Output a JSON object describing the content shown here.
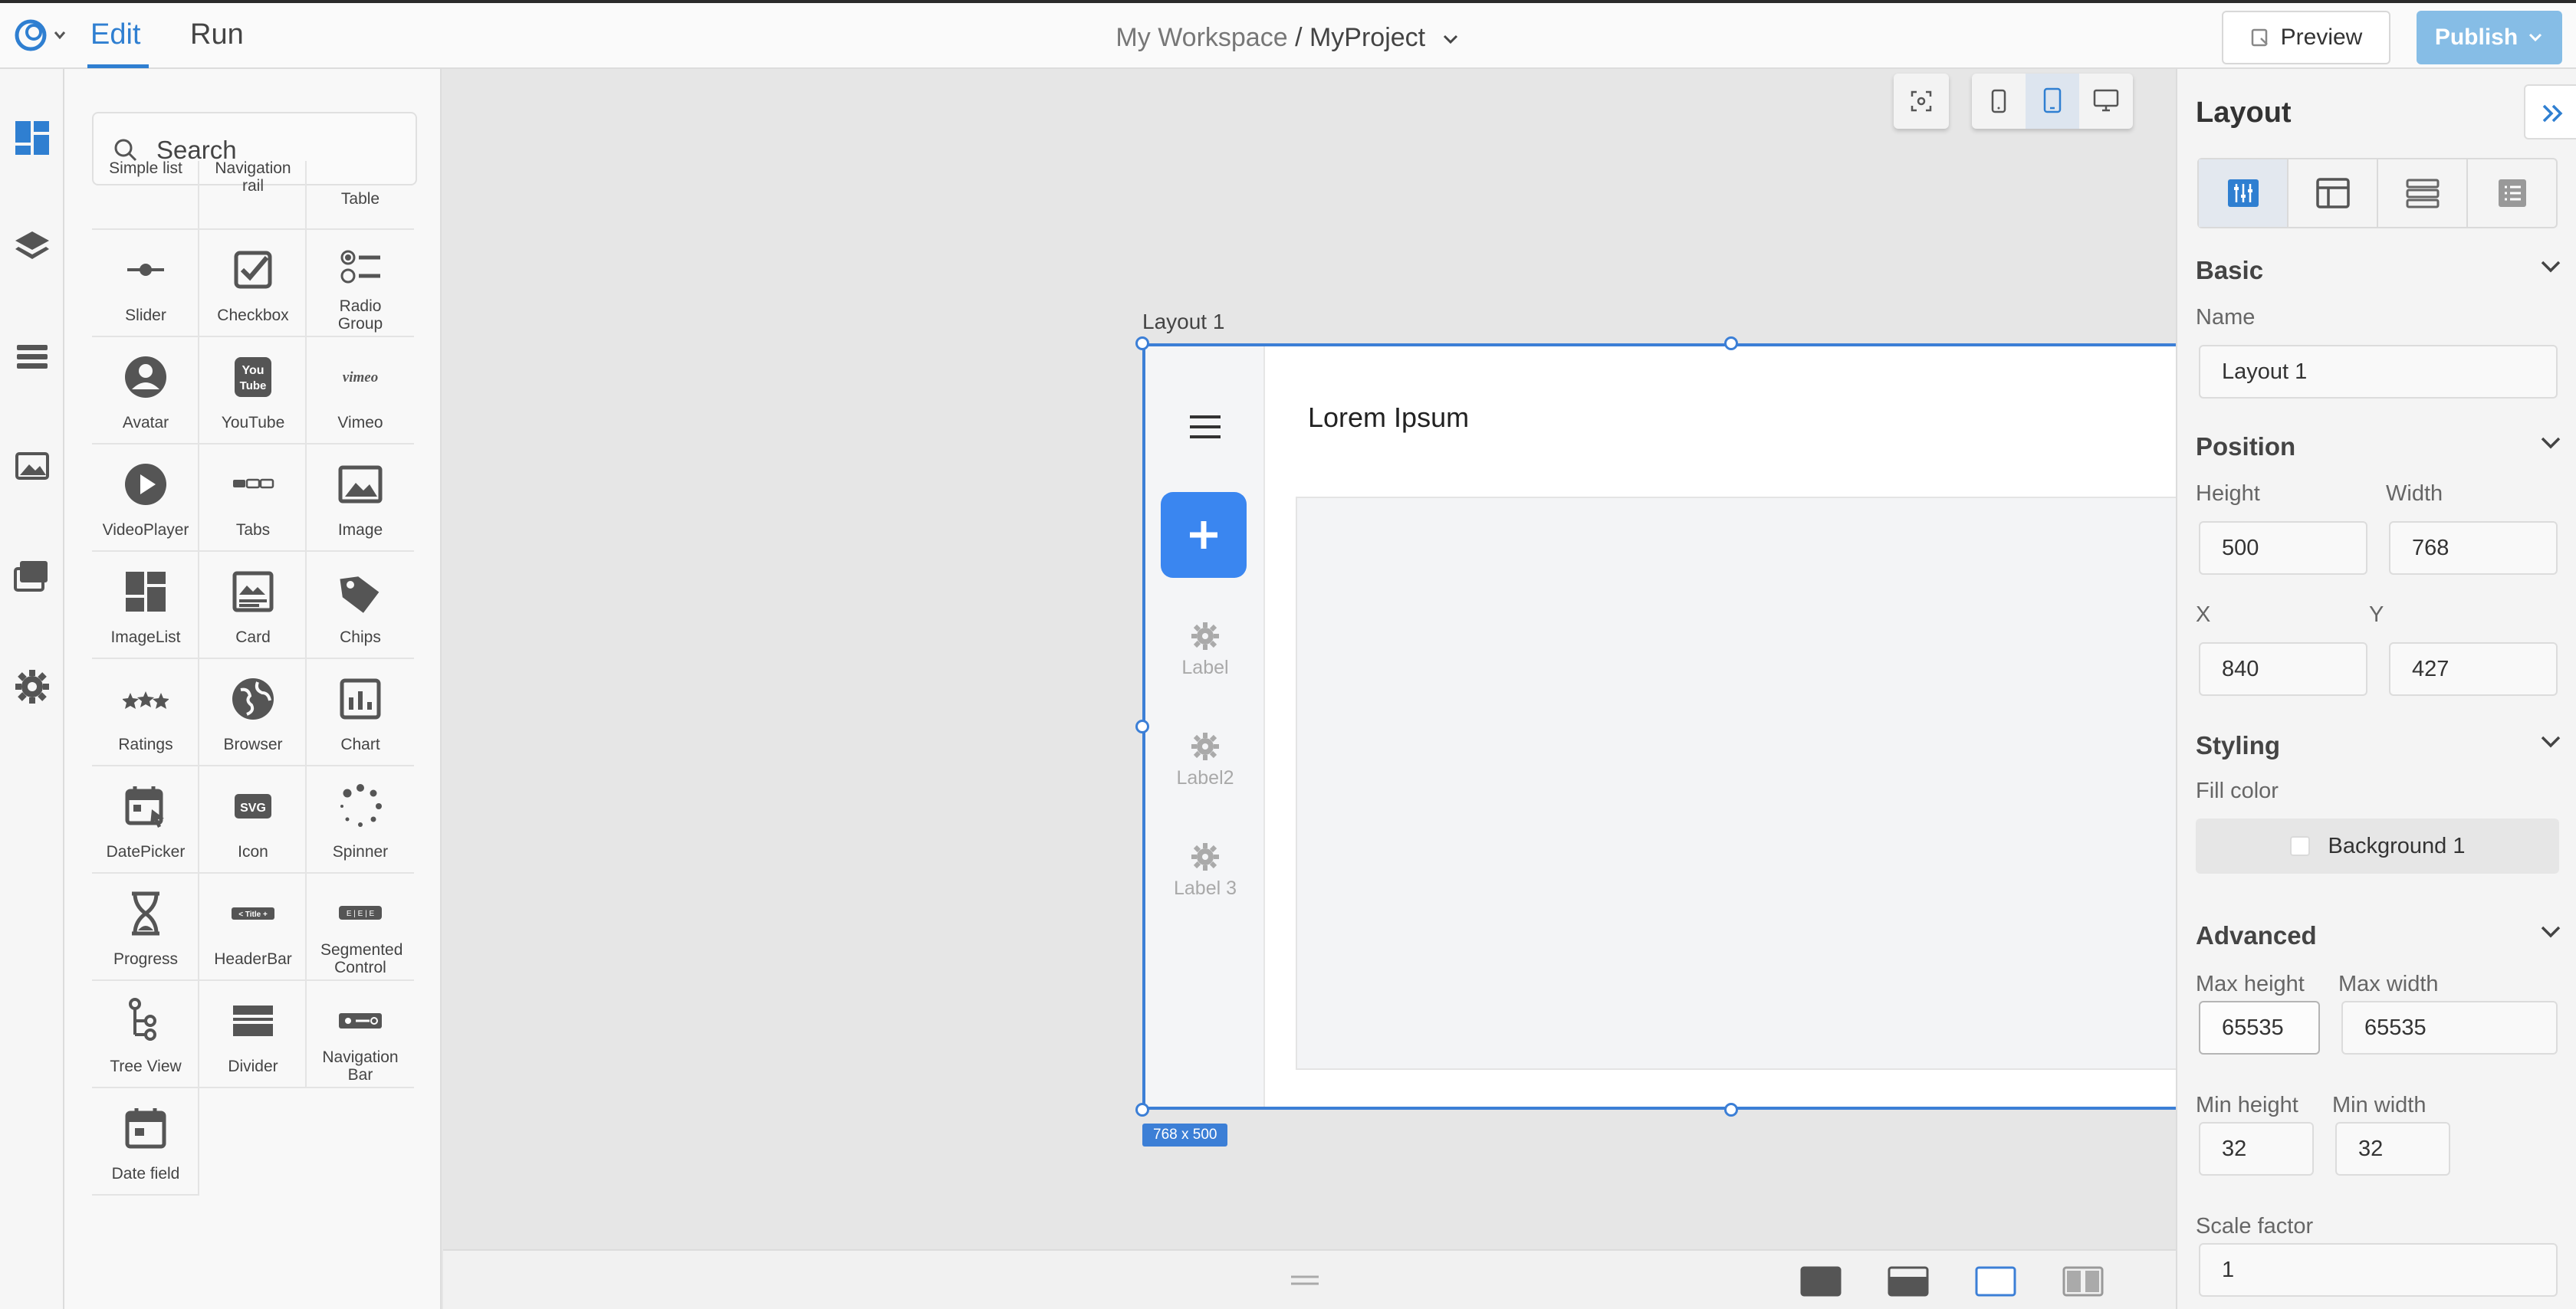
{
  "topbar": {
    "tabs": [
      {
        "label": "Edit"
      },
      {
        "label": "Run"
      }
    ],
    "breadcrumb": {
      "workspace": "My Workspace",
      "separator": " / ",
      "project": "MyProject"
    },
    "preview_label": "Preview",
    "publish_label": "Publish"
  },
  "palette": {
    "search_placeholder": "Search",
    "items": [
      {
        "label": "Simple list",
        "icon": "simple-list-icon"
      },
      {
        "label": "Navigation rail",
        "icon": "navigation-rail-icon"
      },
      {
        "label": "Table",
        "icon": "table-icon"
      },
      {
        "label": "Slider",
        "icon": "slider-icon"
      },
      {
        "label": "Checkbox",
        "icon": "checkbox-icon"
      },
      {
        "label": "Radio Group",
        "icon": "radio-group-icon"
      },
      {
        "label": "Avatar",
        "icon": "avatar-icon"
      },
      {
        "label": "YouTube",
        "icon": "youtube-icon"
      },
      {
        "label": "Vimeo",
        "icon": "vimeo-icon"
      },
      {
        "label": "VideoPlayer",
        "icon": "video-player-icon"
      },
      {
        "label": "Tabs",
        "icon": "tabs-icon"
      },
      {
        "label": "Image",
        "icon": "image-icon"
      },
      {
        "label": "ImageList",
        "icon": "image-list-icon"
      },
      {
        "label": "Card",
        "icon": "card-icon"
      },
      {
        "label": "Chips",
        "icon": "chips-icon"
      },
      {
        "label": "Ratings",
        "icon": "ratings-icon"
      },
      {
        "label": "Browser",
        "icon": "browser-icon"
      },
      {
        "label": "Chart",
        "icon": "chart-icon"
      },
      {
        "label": "DatePicker",
        "icon": "date-picker-icon"
      },
      {
        "label": "Icon",
        "icon": "svg-icon"
      },
      {
        "label": "Spinner",
        "icon": "spinner-icon"
      },
      {
        "label": "Progress",
        "icon": "progress-icon"
      },
      {
        "label": "HeaderBar",
        "icon": "header-bar-icon"
      },
      {
        "label": "Segmented Control",
        "icon": "segmented-control-icon"
      },
      {
        "label": "Tree View",
        "icon": "tree-view-icon"
      },
      {
        "label": "Divider",
        "icon": "divider-icon"
      },
      {
        "label": "Navigation Bar",
        "icon": "navigation-bar-icon"
      },
      {
        "label": "Date field",
        "icon": "date-field-icon"
      }
    ],
    "icon_text": {
      "youtube_top": "You",
      "youtube_bottom": "Tube",
      "vimeo": "vimeo",
      "svg": "SVG",
      "headerbar": "< Title +",
      "segmented": "E | E | E"
    }
  },
  "canvas": {
    "layout_label": "Layout 1",
    "frame_title": "Lorem Ipsum",
    "size_badge": "768 x 500",
    "rail_items": [
      {
        "label": "Label"
      },
      {
        "label": "Label2"
      },
      {
        "label": "Label 3"
      }
    ]
  },
  "props": {
    "title": "Layout",
    "sections": {
      "basic": "Basic",
      "position": "Position",
      "styling": "Styling",
      "advanced": "Advanced"
    },
    "name_label": "Name",
    "name_value": "Layout 1",
    "height_label": "Height",
    "height_value": "500",
    "width_label": "Width",
    "width_value": "768",
    "x_label": "X",
    "x_value": "840",
    "y_label": "Y",
    "y_value": "427",
    "fill_label": "Fill color",
    "fill_value": "Background 1",
    "max_height_label": "Max height",
    "max_height_value": "65535",
    "max_width_label": "Max width",
    "max_width_value": "65535",
    "min_height_label": "Min height",
    "min_height_value": "32",
    "min_width_label": "Min width",
    "min_width_value": "32",
    "scale_label": "Scale factor",
    "scale_value": "1"
  },
  "colors": {
    "accent": "#2f7fd1",
    "selection": "#3c7fd6",
    "fab": "#3a86f0",
    "publish": "#86bde6"
  }
}
